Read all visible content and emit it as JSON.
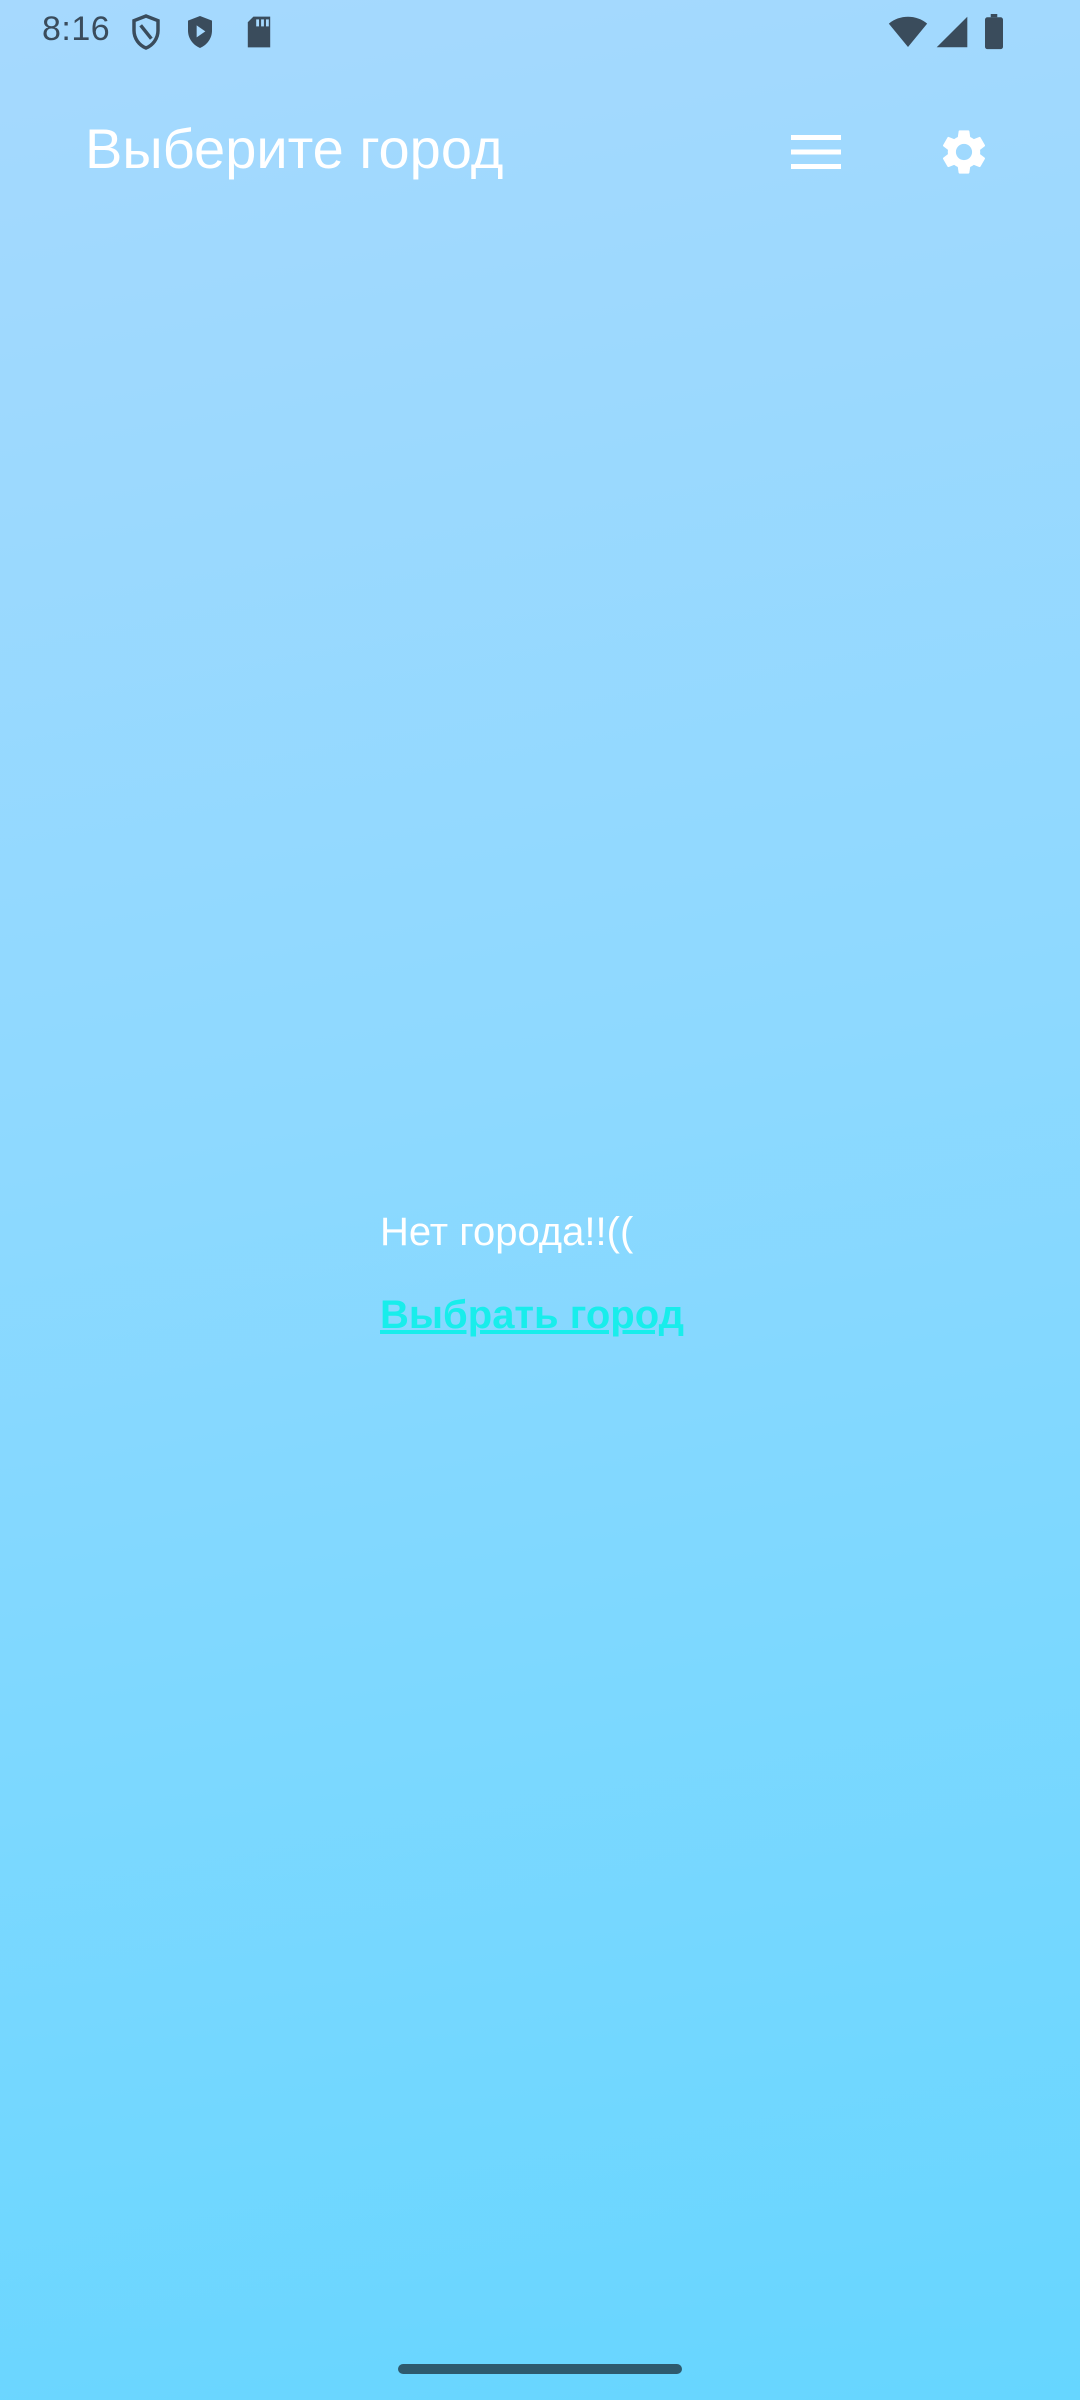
{
  "status_bar": {
    "time": "8:16",
    "icons_left": [
      "shield-outline-icon",
      "play-shield-icon",
      "sd-card-icon"
    ],
    "icons_right": [
      "wifi-icon",
      "cellular-signal-icon",
      "battery-icon"
    ]
  },
  "app_bar": {
    "title": "Выберите город",
    "menu_icon": "hamburger-menu-icon",
    "settings_icon": "gear-icon"
  },
  "main": {
    "empty_message": "Нет города!!((",
    "choose_city_link": "Выбрать город"
  },
  "colors": {
    "background_top": "#A6D9FE",
    "background_bottom": "#66D6FF",
    "link": "#18EDEB",
    "text": "#FFFFFF",
    "status_icons": "#3A4C5C"
  }
}
